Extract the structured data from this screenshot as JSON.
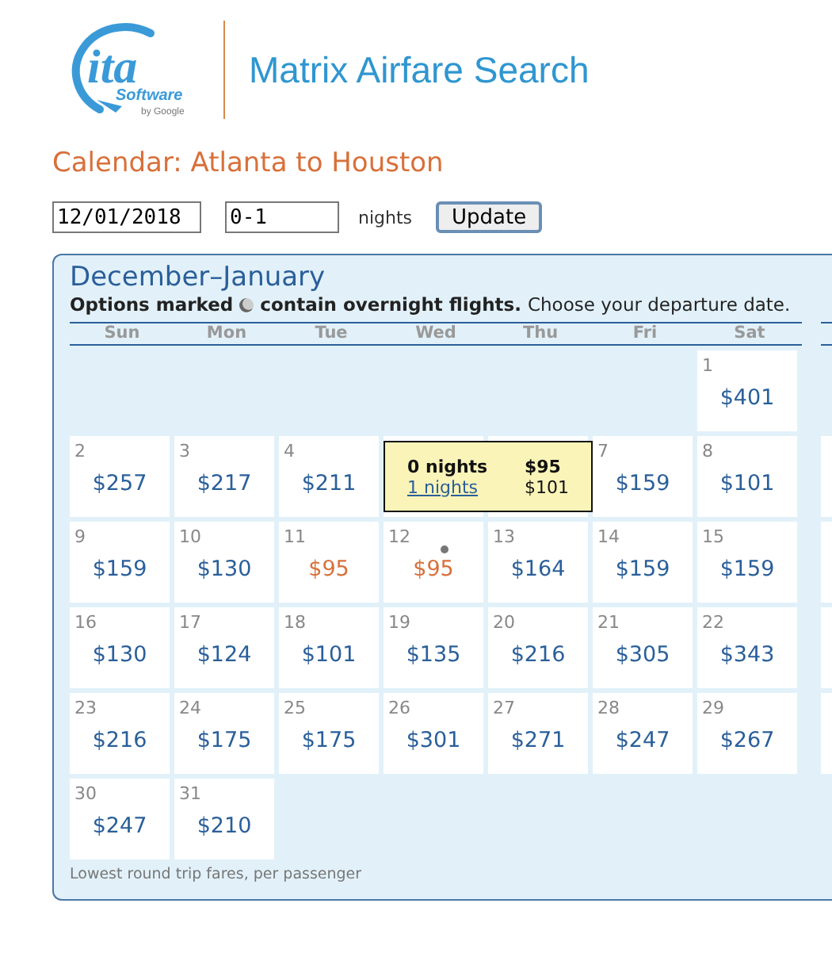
{
  "logo": {
    "mark": "ita",
    "name": "Software",
    "byline": "by Google"
  },
  "app_title": "Matrix Airfare Search",
  "page_title": "Calendar: Atlanta to Houston",
  "form": {
    "date": "12/01/2018",
    "nights": "0-1",
    "nights_label": "nights",
    "button": "Update"
  },
  "calendar": {
    "heading": "December–January",
    "note_bold_start": "Options marked",
    "note_bold_end": "contain overnight flights.",
    "note_rest": "Choose your departure date.",
    "weekdays": [
      "Sun",
      "Mon",
      "Tue",
      "Wed",
      "Thu",
      "Fri",
      "Sat"
    ],
    "weeks": [
      [
        {
          "kind": "blank"
        },
        {
          "kind": "blank"
        },
        {
          "kind": "blank"
        },
        {
          "kind": "blank"
        },
        {
          "kind": "blank"
        },
        {
          "kind": "blank"
        },
        {
          "kind": "day",
          "day": "1",
          "price": "$401",
          "cheapest": false,
          "overnight": false
        }
      ],
      [
        {
          "kind": "day",
          "day": "2",
          "price": "$257",
          "cheapest": false,
          "overnight": false
        },
        {
          "kind": "day",
          "day": "3",
          "price": "$217",
          "cheapest": false,
          "overnight": false
        },
        {
          "kind": "day",
          "day": "4",
          "price": "$211",
          "cheapest": false,
          "overnight": false
        },
        {
          "kind": "covered"
        },
        {
          "kind": "covered"
        },
        {
          "kind": "day",
          "day": "7",
          "price": "$159",
          "cheapest": false,
          "overnight": false
        },
        {
          "kind": "day",
          "day": "8",
          "price": "$101",
          "cheapest": false,
          "overnight": false
        }
      ],
      [
        {
          "kind": "day",
          "day": "9",
          "price": "$159",
          "cheapest": false,
          "overnight": false
        },
        {
          "kind": "day",
          "day": "10",
          "price": "$130",
          "cheapest": false,
          "overnight": false
        },
        {
          "kind": "day",
          "day": "11",
          "price": "$95",
          "cheapest": true,
          "overnight": false
        },
        {
          "kind": "day",
          "day": "12",
          "price": "$95",
          "cheapest": true,
          "overnight": true
        },
        {
          "kind": "day",
          "day": "13",
          "price": "$164",
          "cheapest": false,
          "overnight": false
        },
        {
          "kind": "day",
          "day": "14",
          "price": "$159",
          "cheapest": false,
          "overnight": false
        },
        {
          "kind": "day",
          "day": "15",
          "price": "$159",
          "cheapest": false,
          "overnight": false
        }
      ],
      [
        {
          "kind": "day",
          "day": "16",
          "price": "$130",
          "cheapest": false,
          "overnight": false
        },
        {
          "kind": "day",
          "day": "17",
          "price": "$124",
          "cheapest": false,
          "overnight": false
        },
        {
          "kind": "day",
          "day": "18",
          "price": "$101",
          "cheapest": false,
          "overnight": false
        },
        {
          "kind": "day",
          "day": "19",
          "price": "$135",
          "cheapest": false,
          "overnight": false
        },
        {
          "kind": "day",
          "day": "20",
          "price": "$216",
          "cheapest": false,
          "overnight": false
        },
        {
          "kind": "day",
          "day": "21",
          "price": "$305",
          "cheapest": false,
          "overnight": false
        },
        {
          "kind": "day",
          "day": "22",
          "price": "$343",
          "cheapest": false,
          "overnight": false
        }
      ],
      [
        {
          "kind": "day",
          "day": "23",
          "price": "$216",
          "cheapest": false,
          "overnight": false
        },
        {
          "kind": "day",
          "day": "24",
          "price": "$175",
          "cheapest": false,
          "overnight": false
        },
        {
          "kind": "day",
          "day": "25",
          "price": "$175",
          "cheapest": false,
          "overnight": false
        },
        {
          "kind": "day",
          "day": "26",
          "price": "$301",
          "cheapest": false,
          "overnight": false
        },
        {
          "kind": "day",
          "day": "27",
          "price": "$271",
          "cheapest": false,
          "overnight": false
        },
        {
          "kind": "day",
          "day": "28",
          "price": "$247",
          "cheapest": false,
          "overnight": false
        },
        {
          "kind": "day",
          "day": "29",
          "price": "$267",
          "cheapest": false,
          "overnight": false
        }
      ],
      [
        {
          "kind": "day",
          "day": "30",
          "price": "$247",
          "cheapest": false,
          "overnight": false
        },
        {
          "kind": "day",
          "day": "31",
          "price": "$210",
          "cheapest": false,
          "overnight": false
        },
        {
          "kind": "blank"
        },
        {
          "kind": "blank"
        },
        {
          "kind": "blank"
        },
        {
          "kind": "blank"
        },
        {
          "kind": "blank"
        }
      ]
    ],
    "tooltip": {
      "options": [
        {
          "nights": "0 nights",
          "price": "$95",
          "selected": true
        },
        {
          "nights": "1 nights",
          "price": "$101",
          "selected": false
        }
      ]
    },
    "footnote": "Lowest round trip fares, per passenger"
  }
}
